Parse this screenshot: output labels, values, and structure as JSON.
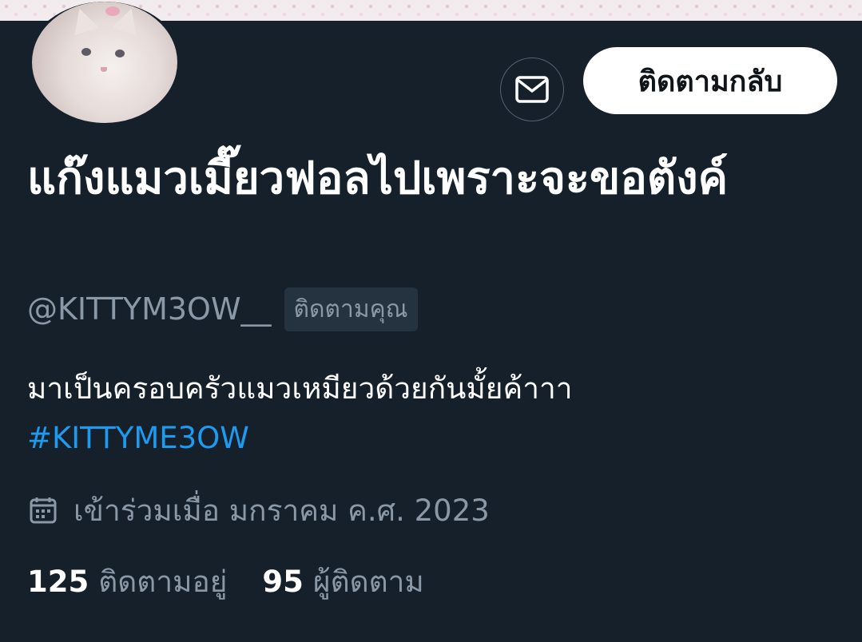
{
  "profile": {
    "display_name": "แก๊งแมวเมี๊ยวฟอลไปเพราะจะขอตังค์",
    "handle": "@KITTYM3OW__",
    "follows_you_badge": "ติดตามคุณ",
    "bio_text": "มาเป็นครอบครัวแมวเหมียวด้วยกันมั้ยค้าาา",
    "bio_hashtag": "#KITTYME3OW",
    "joined": "เข้าร่วมเมื่อ มกราคม ค.ศ. 2023",
    "following_count": "125",
    "following_label": "ติดตามอยู่",
    "followers_count": "95",
    "followers_label": "ผู้ติดตาม"
  },
  "actions": {
    "follow_back_label": "ติดตามกลับ",
    "message_icon": "envelope-icon"
  },
  "icons": {
    "joined": "calendar-icon"
  },
  "colors": {
    "background": "#15202b",
    "accent": "#1d9bf0",
    "secondary_text": "#8b98a5"
  }
}
